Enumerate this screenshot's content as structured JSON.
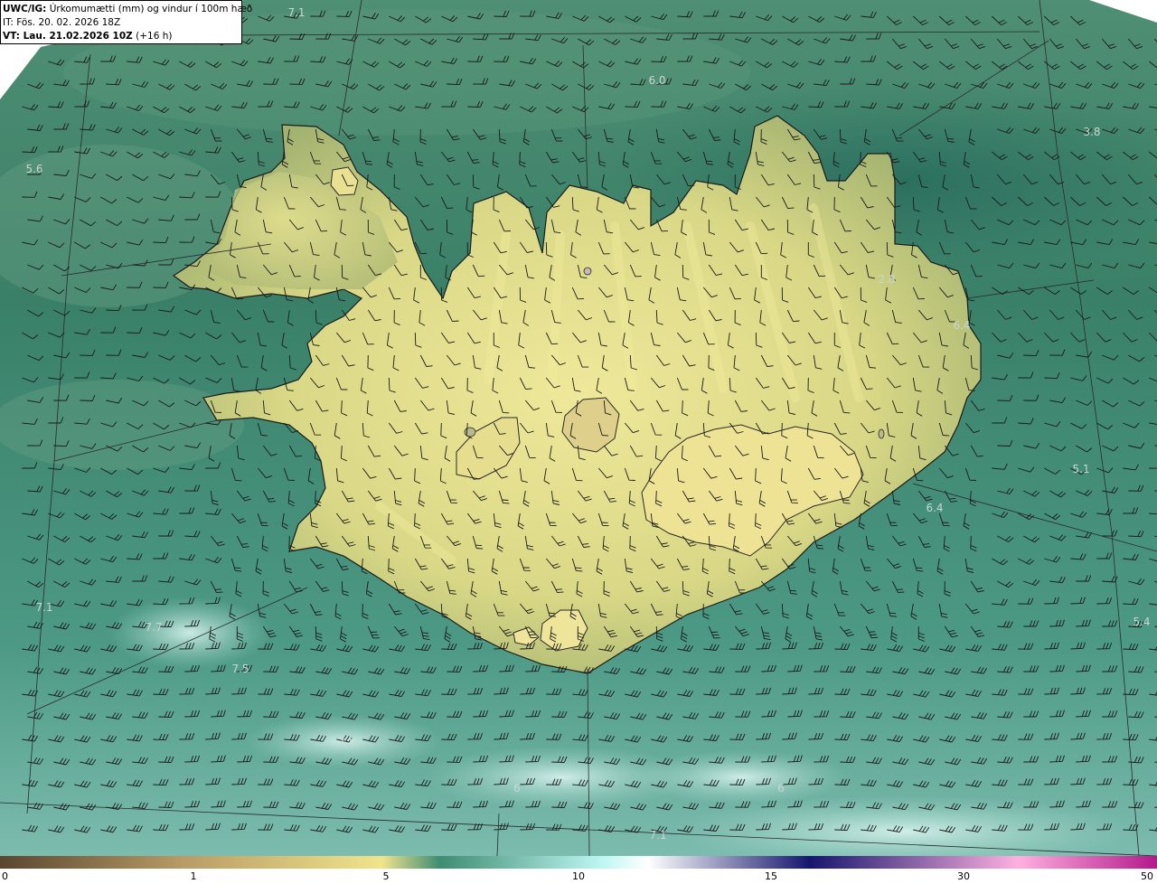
{
  "header": {
    "product_code": "UWC/IG:",
    "product_title": "Úrkomumætti (mm) og vindur í 100m hæð",
    "init_line": "IT: Fös. 20. 02. 2026 18Z",
    "valid_prefix": "VT: Lau. 21.02.2026 10Z",
    "valid_offset": "(+16 h)"
  },
  "colorbar": {
    "ticks": [
      {
        "value": 0,
        "label": "0"
      },
      {
        "value": 1,
        "label": "1"
      },
      {
        "value": 5,
        "label": "5"
      },
      {
        "value": 10,
        "label": "10"
      },
      {
        "value": 15,
        "label": "15"
      },
      {
        "value": 30,
        "label": "30"
      },
      {
        "value": 50,
        "label": "50"
      }
    ],
    "colors": [
      "#5a4630",
      "#b99c66",
      "#f0e48c",
      "#3e8d72",
      "#bdf6f2",
      "#ffffff",
      "#16166e",
      "#ffb0e0",
      "#b4198c"
    ]
  },
  "map_labels": [
    {
      "text": "7.1"
    },
    {
      "text": "6.0"
    },
    {
      "text": "3.8"
    },
    {
      "text": "5.6"
    },
    {
      "text": "2.8"
    },
    {
      "text": "6.4"
    },
    {
      "text": "5.1"
    },
    {
      "text": "6.4"
    },
    {
      "text": "7.1"
    },
    {
      "text": "7.7"
    },
    {
      "text": "7.5"
    },
    {
      "text": "5.4"
    },
    {
      "text": "7.5"
    },
    {
      "text": "6"
    },
    {
      "text": "6"
    },
    {
      "text": "7.1"
    }
  ],
  "colors": {
    "ocean_dark": "#2e7a66",
    "ocean_light": "#7fbfb2",
    "land_low": "#a9b36f",
    "land_high": "#eeea96",
    "barb": "#1a1a1a",
    "grid": "#2a2a2a"
  }
}
